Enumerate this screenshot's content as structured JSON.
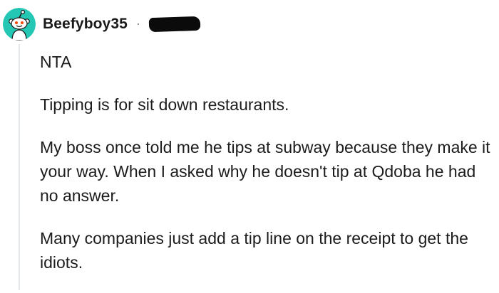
{
  "comment": {
    "username": "Beefyboy35",
    "separator": "·",
    "avatar_icon": "reddit-snoo-avatar-icon",
    "accent_color": "#24c7b4",
    "paragraphs": [
      "NTA",
      "Tipping is for sit down restaurants.",
      "My boss once told me he tips at subway because they make it your way. When I asked why he doesn't tip at Qdoba he had no answer.",
      "Many companies just add a tip line on the receipt to get the idiots."
    ]
  }
}
